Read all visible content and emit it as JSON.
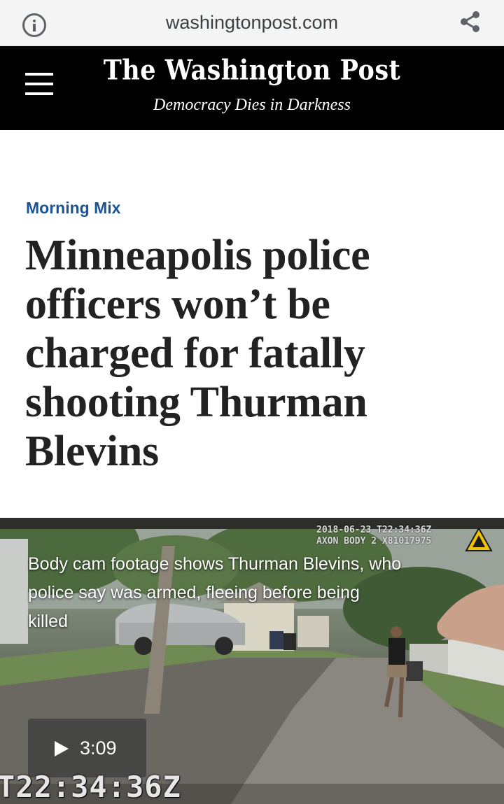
{
  "browser": {
    "url": "washingtonpost.com",
    "info_icon": "info-icon",
    "share_icon": "share-icon"
  },
  "masthead": {
    "menu_icon": "hamburger-menu-icon",
    "logo": "The Washington Post",
    "tagline": "Democracy Dies in Darkness"
  },
  "article": {
    "kicker": "Morning Mix",
    "headline_lines": [
      "Minneapolis police",
      "officers won’t be",
      "charged for fatally",
      "shooting Thurman",
      "Blevins"
    ]
  },
  "video": {
    "camera_timestamp": "2018-06-23  T22:34:36Z",
    "camera_id": "AXON BODY 2 X81017975",
    "caption_lines": [
      "Body cam footage shows Thurman Blevins, who",
      "police say was armed, fleeing before being",
      "killed"
    ],
    "duration": "3:09",
    "play_icon": "play-icon",
    "overlay_timestamp": "T22:34:36Z",
    "badge_icon": "axon-warning-icon"
  },
  "colors": {
    "masthead_bg": "#000000",
    "kicker": "#1b5496",
    "headline": "#222222",
    "urlbar_bg": "#f4f4f4"
  }
}
